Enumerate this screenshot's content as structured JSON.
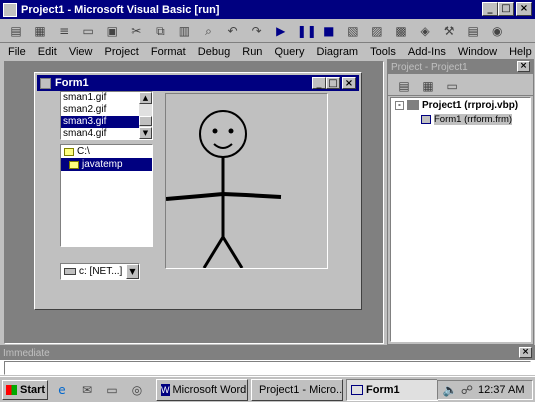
{
  "app": {
    "title": "Project1 - Microsoft Visual Basic [run]",
    "menu": [
      "File",
      "Edit",
      "View",
      "Project",
      "Format",
      "Debug",
      "Run",
      "Query",
      "Diagram",
      "Tools",
      "Add-Ins",
      "Window",
      "Help"
    ]
  },
  "form": {
    "title": "Form1",
    "files": [
      "sman1.gif",
      "sman2.gif",
      "sman3.gif",
      "sman4.gif"
    ],
    "selected_file": "sman3.gif",
    "dirs": [
      "C:\\",
      "javatemp"
    ],
    "drive": "c: [NET...]"
  },
  "project": {
    "title": "Project - Project1",
    "root": "Project1 (rrproj.vbp)",
    "child": "Form1 (rrform.frm)"
  },
  "immediate": {
    "title": "Immediate"
  },
  "taskbar": {
    "start": "Start",
    "tasks": [
      "Microsoft Word",
      "Project1 - Micro...",
      "Form1"
    ],
    "clock": "12:37 AM"
  },
  "colors": {
    "titlebar": "#000080",
    "desktop": "#808080"
  }
}
